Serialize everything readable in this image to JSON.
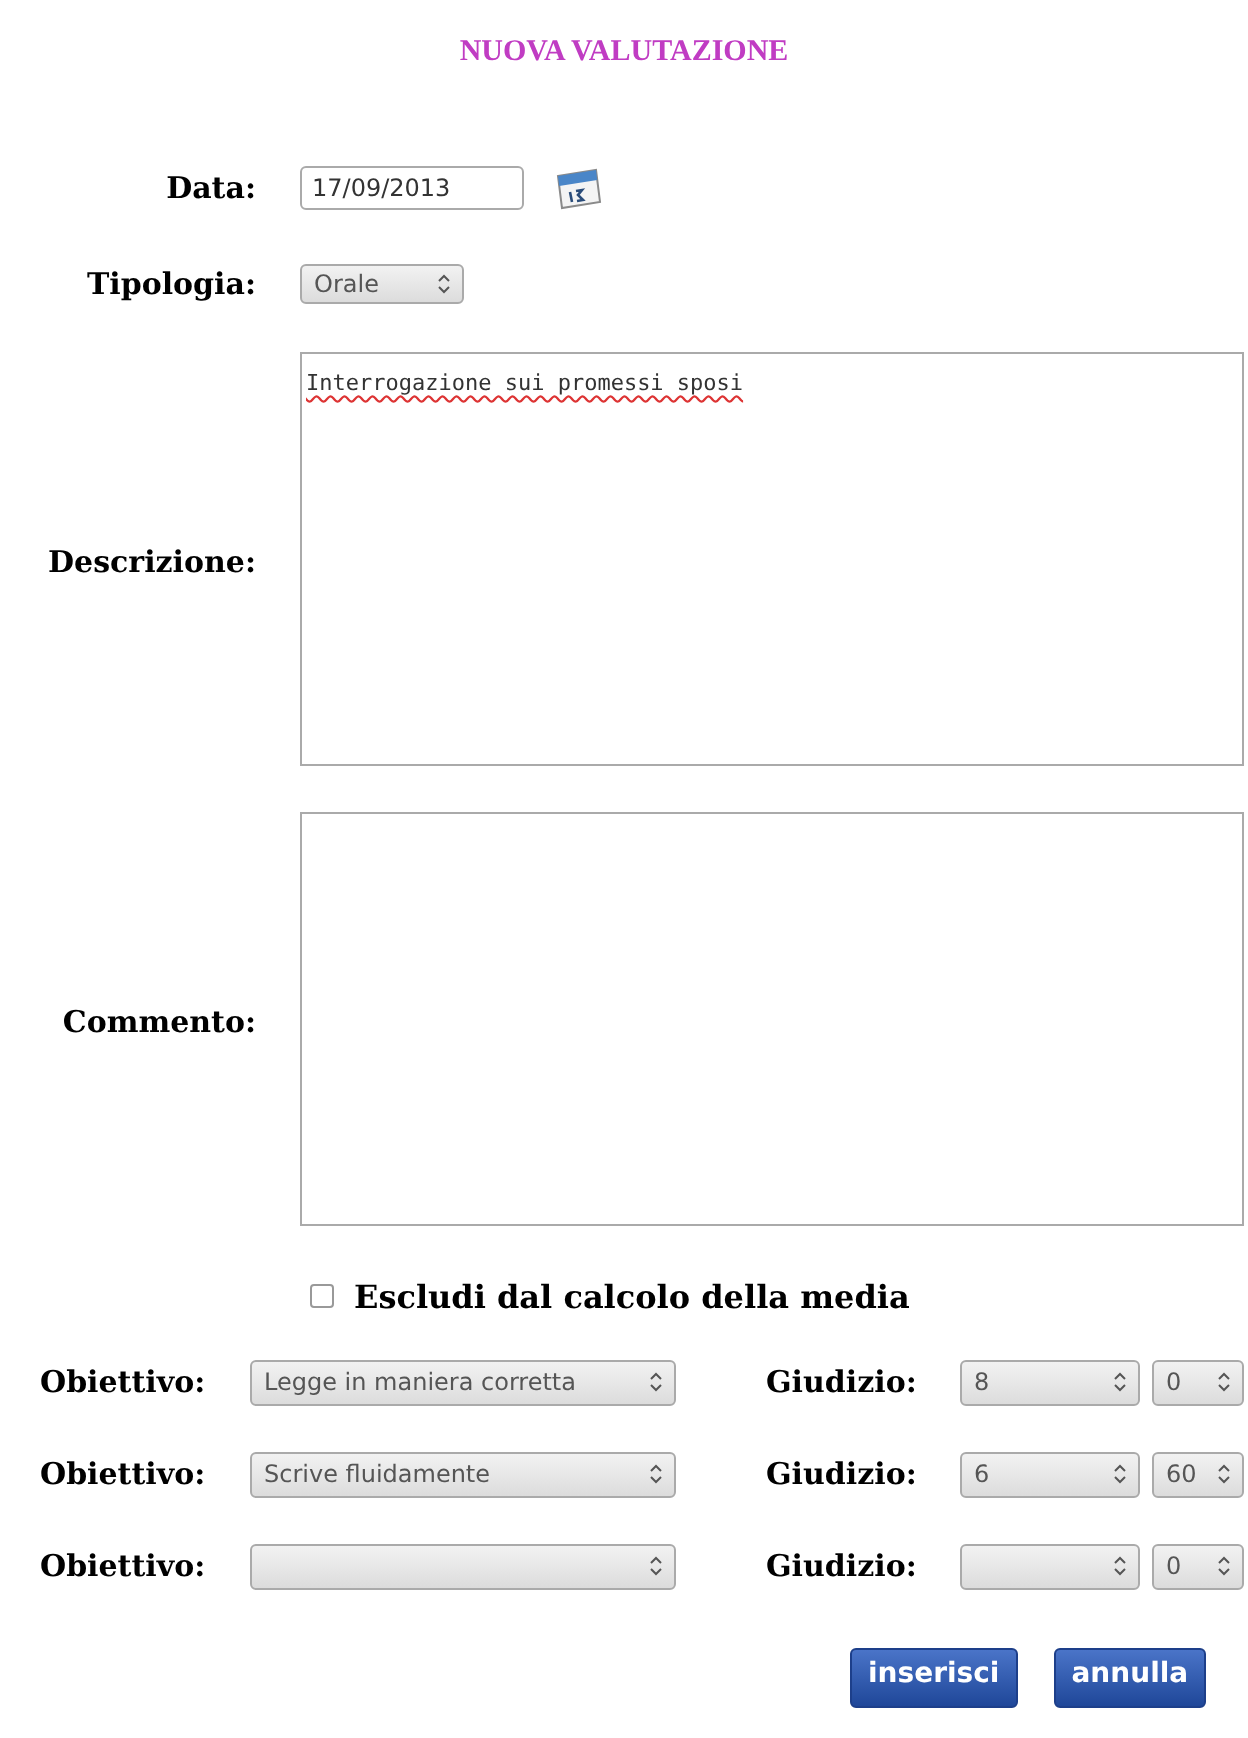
{
  "title": "NUOVA VALUTAZIONE",
  "fields": [
    {
      "kind": "date",
      "label": "Data:",
      "value": "17/09/2013"
    },
    {
      "kind": "select",
      "label": "Tipologia:",
      "value": "Orale"
    },
    {
      "kind": "textarea",
      "label": "Descrizione:",
      "value": "Interrogazione sui promessi sposi"
    },
    {
      "kind": "textarea",
      "label": "Commento:"
    }
  ],
  "exclude": {
    "label": "Escludi dal calcolo della media",
    "checked": false
  },
  "objectives": [
    {
      "label": "Obiettivo:",
      "value": "Legge in maniera corretta",
      "grade_label": "Giudizio:",
      "grade": "8",
      "fraction": "0"
    },
    {
      "label": "Obiettivo:",
      "value": "Scrive fluidamente",
      "grade_label": "Giudizio:",
      "grade": "6",
      "fraction": "60"
    },
    {
      "label": "Obiettivo:",
      "grade_label": "Giudizio:",
      "fraction": "0"
    }
  ],
  "buttons": [
    "inserisci",
    "annulla"
  ]
}
